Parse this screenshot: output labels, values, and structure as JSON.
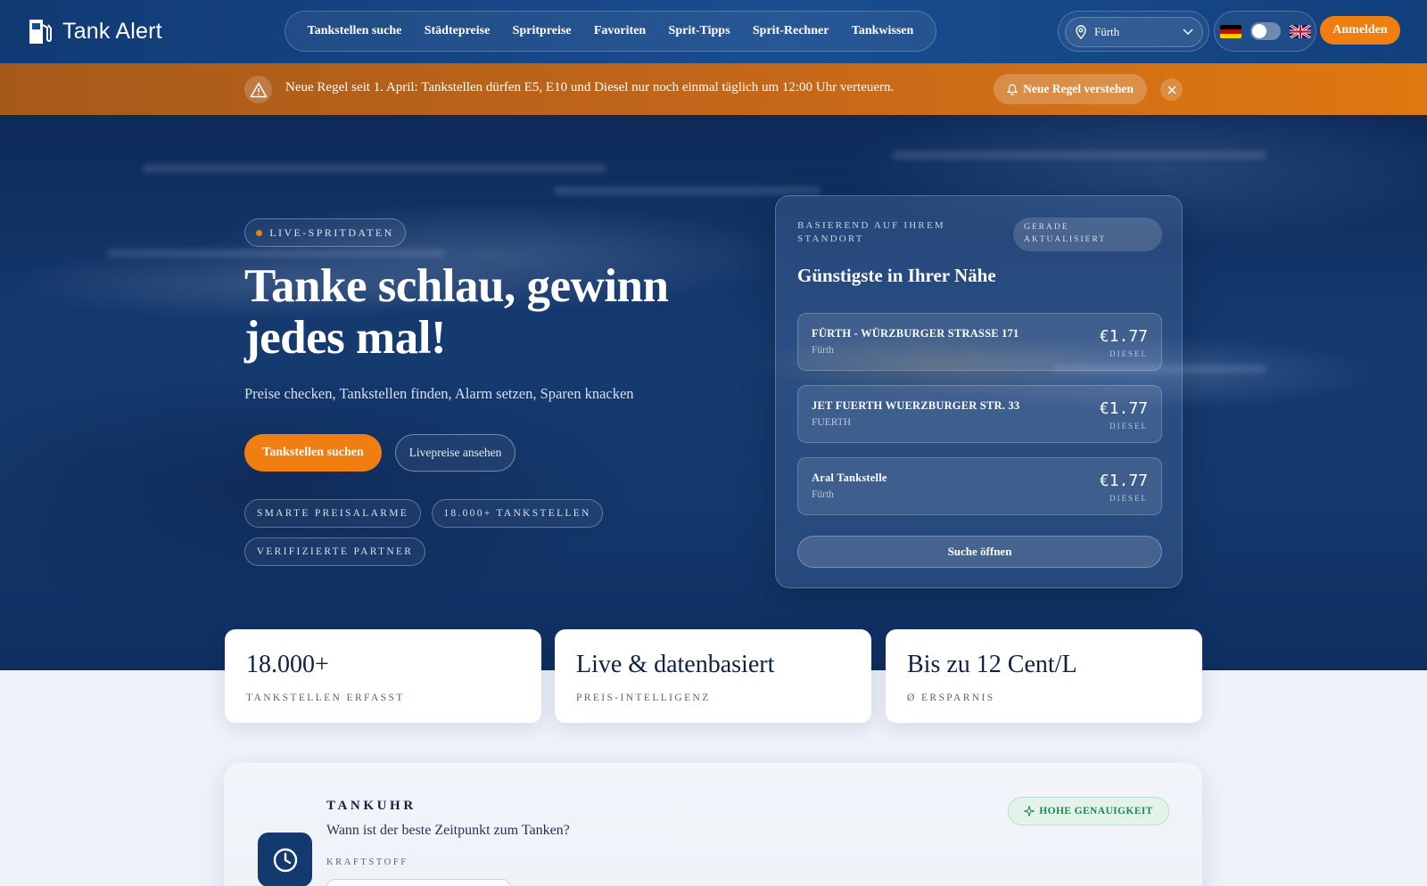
{
  "nav": {
    "brand": "Tank Alert",
    "links": [
      "Tankstellen suche",
      "Städtepreise",
      "Spritpreise",
      "Favoriten",
      "Sprit-Tipps",
      "Sprit-Rechner",
      "Tankwissen"
    ],
    "location": "Fürth",
    "login": "Anmelden"
  },
  "alert": {
    "text": "Neue Regel seit 1. April: Tankstellen dürfen E5, E10 und Diesel nur noch einmal täglich um 12:00 Uhr verteuern.",
    "button": "Neue Regel verstehen"
  },
  "hero": {
    "badge": "LIVE-SPRITDATEN",
    "title": "Tanke schlau, gewinn jedes mal!",
    "subtitle": "Preise checken, Tankstellen finden, Alarm setzen, Sparen knacken",
    "primary_button": "Tankstellen suchen",
    "secondary_button": "Livepreise ansehen",
    "chips": [
      "SMARTE PREISALARME",
      "18.000+ TANKSTELLEN",
      "VERIFIZIERTE PARTNER"
    ]
  },
  "nearby": {
    "label": "BASIEREND AUF IHREM STANDORT",
    "updated": "GERADE AKTUALISIERT",
    "title": "Günstigste in Ihrer Nähe",
    "stations": [
      {
        "name": "FÜRTH - WÜRZBURGER STRASSE 171",
        "city": "Fürth",
        "price": "€1.77",
        "fuel": "DIESEL"
      },
      {
        "name": "JET FUERTH WUERZBURGER STR. 33",
        "city": "FUERTH",
        "price": "€1.77",
        "fuel": "DIESEL"
      },
      {
        "name": "Aral Tankstelle",
        "city": "Fürth",
        "price": "€1.77",
        "fuel": "DIESEL"
      }
    ],
    "open_button": "Suche öffnen"
  },
  "stats": [
    {
      "value": "18.000+",
      "label": "TANKSTELLEN ERFASST"
    },
    {
      "value": "Live & datenbasiert",
      "label": "PREIS-INTELLIGENZ"
    },
    {
      "value": "Bis zu 12 Cent/L",
      "label": "Ø ERSPARNIS"
    }
  ],
  "tankuhr": {
    "title": "TANKUHR",
    "question": "Wann ist der beste Zeitpunkt zum Tanken?",
    "fuel_label": "KRAFTSTOFF",
    "accuracy": "HOHE GENAUIGKEIT"
  },
  "colors": {
    "accent": "#f07e10",
    "navy": "#113a74",
    "success": "#1d8a4a"
  }
}
